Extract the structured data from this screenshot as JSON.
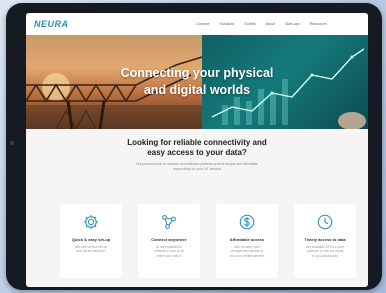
{
  "brand": {
    "logo": "NEURA"
  },
  "nav": {
    "items": [
      "Connect",
      "Solutions",
      "Outlets",
      "About",
      "Start-ups",
      "Resources"
    ]
  },
  "hero": {
    "line1": "Connecting your physical",
    "line2": "and digital worlds"
  },
  "intro": {
    "heading_line1": "Looking for reliable connectivity and",
    "heading_line2": "easy access to your data?",
    "text_line1": "Our process built on network and software platform provide simple and affordable",
    "text_line2": "connectivity for your IoT devices"
  },
  "cards": [
    {
      "icon": "gear-icon",
      "title": "Quick & easy set-up",
      "desc_line1": "with self service set-up",
      "desc_line2": "and device selection"
    },
    {
      "icon": "network-icon",
      "title": "Connect anywhere",
      "desc_line1": "to our established",
      "desc_line2": "network or ours to all",
      "desc_line3": "where you need it"
    },
    {
      "icon": "dollar-icon",
      "title": "Affordable access",
      "desc_line1": "with no setup user",
      "desc_line2": "changes and access to",
      "desc_line3": "our cost certified devices"
    },
    {
      "icon": "clock-icon",
      "title": "Timely access to data",
      "desc_line1": "any available API into your",
      "desc_line2": "systems, or use our ready",
      "desc_line3": "to go Dashboards"
    }
  ],
  "colors": {
    "brand": "#2a8fb5",
    "screen_bg": "#f7f5f3",
    "frame": "#161a22",
    "hero_teal": "#167a7a",
    "hero_sunset": "#e2a770"
  }
}
